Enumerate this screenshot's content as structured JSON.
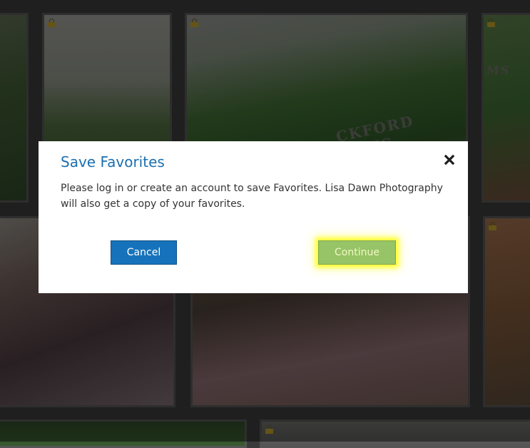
{
  "background_gallery": {
    "tiles": [
      {
        "id": "t1",
        "style": "g1",
        "locked": false
      },
      {
        "id": "t2",
        "style": "g2",
        "locked": true
      },
      {
        "id": "t3",
        "style": "g3",
        "locked": true,
        "sign_text": "CKFORD ARMS"
      },
      {
        "id": "t4",
        "style": "g4",
        "locked": true,
        "sign_text": "MS"
      },
      {
        "id": "t5",
        "style": "i1",
        "locked": false
      },
      {
        "id": "t6",
        "style": "i2",
        "locked": false
      },
      {
        "id": "t7",
        "style": "i3",
        "locked": true
      },
      {
        "id": "t8",
        "style": "b1",
        "locked": false
      },
      {
        "id": "t9",
        "style": "b2",
        "locked": true
      }
    ]
  },
  "modal": {
    "title": "Save Favorites",
    "body": "Please log in or create an account to save Favorites. Lisa Dawn Photography will also get a copy of your favorites.",
    "close_icon": "close-icon",
    "cancel_label": "Cancel",
    "continue_label": "Continue"
  },
  "colors": {
    "title": "#1b6fb0",
    "cancel_bg": "#1673bb",
    "continue_bg": "#96c466",
    "continue_glow": "#ffff00"
  }
}
